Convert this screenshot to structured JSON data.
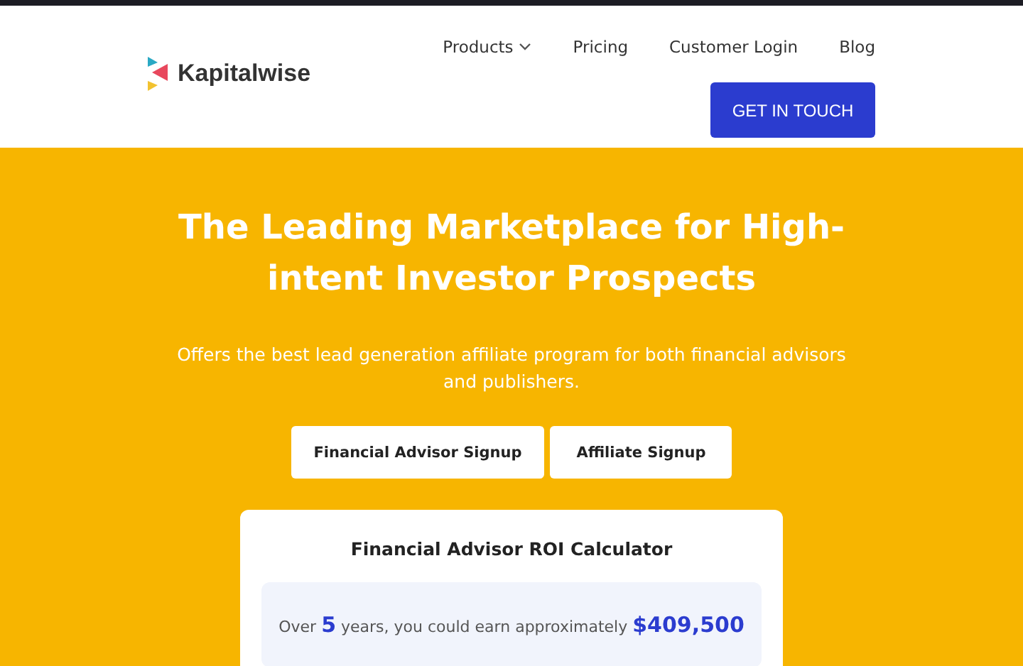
{
  "brand": {
    "name": "Kapitalwise"
  },
  "nav": [
    {
      "label": "Products",
      "kind": "dropdown"
    },
    {
      "label": "Pricing",
      "kind": "link"
    },
    {
      "label": "Customer Login",
      "kind": "link"
    },
    {
      "label": "Blog",
      "kind": "link"
    }
  ],
  "cta": "GET IN TOUCH",
  "hero": {
    "title": "The Leading Marketplace for High-intent Investor Prospects",
    "subtitle": "Offers the best lead generation affiliate program for both financial advisors and publishers.",
    "buttons": [
      "Financial Advisor Signup",
      "Affiliate Signup"
    ]
  },
  "calculator": {
    "title": "Financial Advisor ROI Calculator",
    "result": "Over **5** years, you could earn approximately **$409,500**"
  }
}
